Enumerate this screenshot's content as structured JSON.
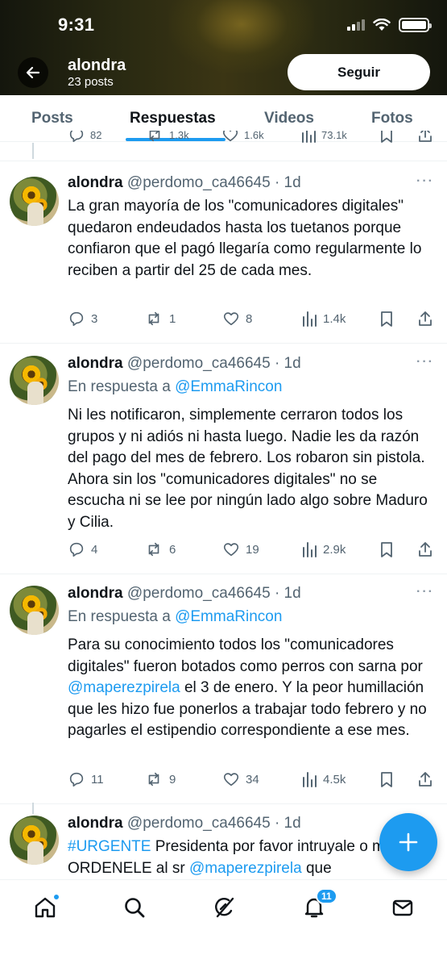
{
  "status_bar": {
    "time": "9:31"
  },
  "header": {
    "name": "alondra",
    "posts_count": "23 posts",
    "follow_label": "Seguir"
  },
  "tabs": [
    {
      "label": "Posts"
    },
    {
      "label": "Respuestas",
      "active": true
    },
    {
      "label": "Videos"
    },
    {
      "label": "Fotos"
    }
  ],
  "partial_tweet": {
    "replies": "82",
    "reposts": "1.3k",
    "likes": "1.6k",
    "views": "73.1k"
  },
  "tweets": [
    {
      "name": "alondra",
      "handle": "@perdomo_ca46645",
      "time": "· 1d",
      "reply_to_label": "",
      "reply_to": "",
      "text": "La gran mayoría de los \"comunicadores digitales\" quedaron endeudados hasta los tuetanos porque confiaron que el pagó llegaría como regularmente lo reciben a partir del 25 de cada mes.",
      "replies": "3",
      "reposts": "1",
      "likes": "8",
      "views": "1.4k"
    },
    {
      "name": "alondra",
      "handle": "@perdomo_ca46645",
      "time": "· 1d",
      "reply_to_label": "En respuesta a",
      "reply_to": "@EmmaRincon",
      "text": "Ni les notificaron, simplemente cerraron todos los grupos y ni adiós ni hasta luego. Nadie les da razón del pago del mes de febrero. Los robaron sin pistola. Ahora sin los \"comunicadores digitales\" no se escucha ni se lee por ningún lado algo sobre Maduro y Cilia.",
      "replies": "4",
      "reposts": "6",
      "likes": "19",
      "views": "2.9k"
    },
    {
      "name": "alondra",
      "handle": "@perdomo_ca46645",
      "time": "· 1d",
      "reply_to_label": "En respuesta a",
      "reply_to": "@EmmaRincon",
      "text_before": "Para su conocimiento todos los \"comunicadores digitales\" fueron botados como perros con sarna por ",
      "text_link": "@maperezpirela",
      "text_after": " el 3 de enero. Y la peor humillación que les hizo fue ponerlos a trabajar todo febrero y no pagarles el estipendio correspondiente a ese mes.",
      "replies": "11",
      "reposts": "9",
      "likes": "34",
      "views": "4.5k"
    },
    {
      "name": "alondra",
      "handle": "@perdomo_ca46645",
      "time": "· 1d",
      "hashtag": "#URGENTE",
      "text_mid": " Presidenta por favor intruyale o mejor ORDENELE al sr ",
      "text_link": "@maperezpirela",
      "text_after": " que"
    }
  ],
  "bottom_nav": {
    "notifications_badge": "11"
  },
  "icons": [
    "back-arrow-icon",
    "reply-icon",
    "repost-icon",
    "like-icon",
    "views-icon",
    "bookmark-icon",
    "share-icon",
    "more-icon",
    "home-icon",
    "search-icon",
    "grok-icon",
    "bell-icon",
    "mail-icon",
    "plus-icon"
  ],
  "colors": {
    "accent": "#1d9bf0",
    "text": "#0f1419",
    "muted": "#536471"
  }
}
